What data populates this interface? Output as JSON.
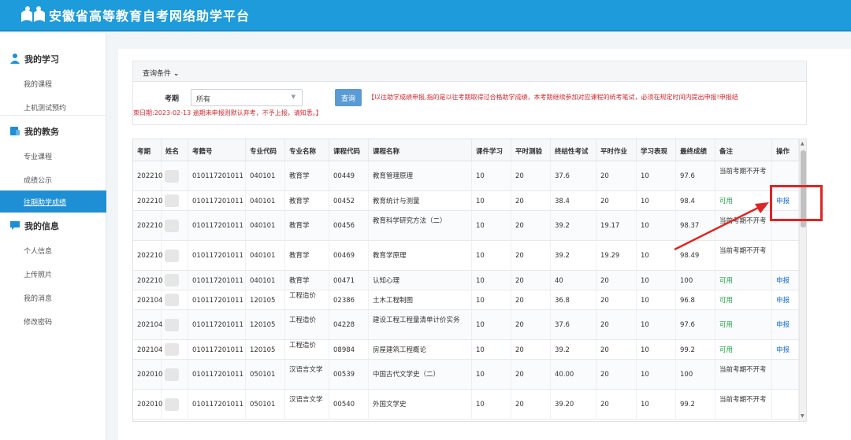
{
  "header": {
    "title": "安徽省高等教育自考网络助学平台"
  },
  "sidebar": {
    "groups": [
      {
        "title": "我的学习",
        "icon": "user-icon",
        "items": [
          "我的课程",
          "上机测试预约"
        ]
      },
      {
        "title": "我的教务",
        "icon": "admin-icon",
        "items": [
          "专业课程",
          "成绩公示",
          "往期助学成绩"
        ]
      },
      {
        "title": "我的信息",
        "icon": "message-icon",
        "items": [
          "个人信息",
          "上传照片",
          "我的消息",
          "修改密码"
        ]
      }
    ],
    "active_item": "往期助学成绩"
  },
  "query": {
    "panel_title": "查询条件",
    "term_label": "考期",
    "term_value": "所有",
    "query_button": "查询",
    "notice_line1": "【以往助学成绩申报,指的是以往考期取得过合格助学成绩，本考期继续参加对应课程的统考笔试，必须在规定时间内提出申报!申报结",
    "notice_line2": "束日期:2023-02-13 逾期未申报则默认弃考，不予上报，请知悉。】"
  },
  "table": {
    "columns": [
      "考期",
      "姓名",
      "考籍号",
      "专业代码",
      "专业名称",
      "课程代码",
      "课程名称",
      "课件学习",
      "平时测验",
      "终结性考试",
      "平时作业",
      "学习表现",
      "最终成绩",
      "备注",
      "操作"
    ],
    "rows": [
      [
        "202210",
        "",
        "010117201011",
        "040101",
        "教育学",
        "00449",
        "教育管理原理",
        "10",
        "20",
        "37.6",
        "20",
        "10",
        "97.6",
        "当前考期不开考",
        ""
      ],
      [
        "202210",
        "",
        "010117201011",
        "040101",
        "教育学",
        "00452",
        "教育统计与测量",
        "10",
        "20",
        "38.4",
        "20",
        "10",
        "98.4",
        "可用",
        "申报"
      ],
      [
        "202210",
        "",
        "010117201011",
        "040101",
        "教育学",
        "00456",
        "教育科学研究方法（二）",
        "10",
        "20",
        "39.2",
        "19.17",
        "10",
        "98.37",
        "当前考期不开考",
        ""
      ],
      [
        "202210",
        "",
        "010117201011",
        "040101",
        "教育学",
        "00469",
        "教育学原理",
        "10",
        "20",
        "39.2",
        "19.29",
        "10",
        "98.49",
        "当前考期不开考",
        ""
      ],
      [
        "202210",
        "",
        "010117201011",
        "040101",
        "教育学",
        "00471",
        "认知心理",
        "10",
        "20",
        "40",
        "20",
        "10",
        "100",
        "可用",
        "申报"
      ],
      [
        "202104",
        "",
        "010117201011",
        "120105",
        "工程造价",
        "02386",
        "土木工程制图",
        "10",
        "20",
        "36.8",
        "20",
        "10",
        "96.8",
        "可用",
        "申报"
      ],
      [
        "202104",
        "",
        "010117201011",
        "120105",
        "工程造价",
        "04228",
        "建设工程工程量清单计价实务",
        "10",
        "20",
        "37.6",
        "20",
        "10",
        "97.6",
        "可用",
        "申报"
      ],
      [
        "202104",
        "",
        "010117201011",
        "120105",
        "工程造价",
        "08984",
        "房屋建筑工程概论",
        "10",
        "20",
        "39.2",
        "20",
        "10",
        "99.2",
        "可用",
        "申报"
      ],
      [
        "202010",
        "",
        "010117201011",
        "050101",
        "汉语言文学",
        "00539",
        "中国古代文学史（二）",
        "10",
        "20",
        "40.00",
        "20",
        "10",
        "100",
        "当前考期不开考",
        ""
      ],
      [
        "202010",
        "",
        "010117201011",
        "050101",
        "汉语言文学",
        "00540",
        "外国文学史",
        "10",
        "20",
        "39.20",
        "20",
        "10",
        "99.2",
        "当前考期不开考",
        ""
      ]
    ]
  },
  "colors": {
    "header_bg": "#1e9bdb",
    "active_nav": "#1e8fd4",
    "notice_red": "#d9262e",
    "ok_green": "#24a34a",
    "link_blue": "#1e73c8",
    "annotation_red": "#e02424"
  },
  "annotation": {
    "shape": "red-box-and-arrow",
    "target": "申报"
  }
}
